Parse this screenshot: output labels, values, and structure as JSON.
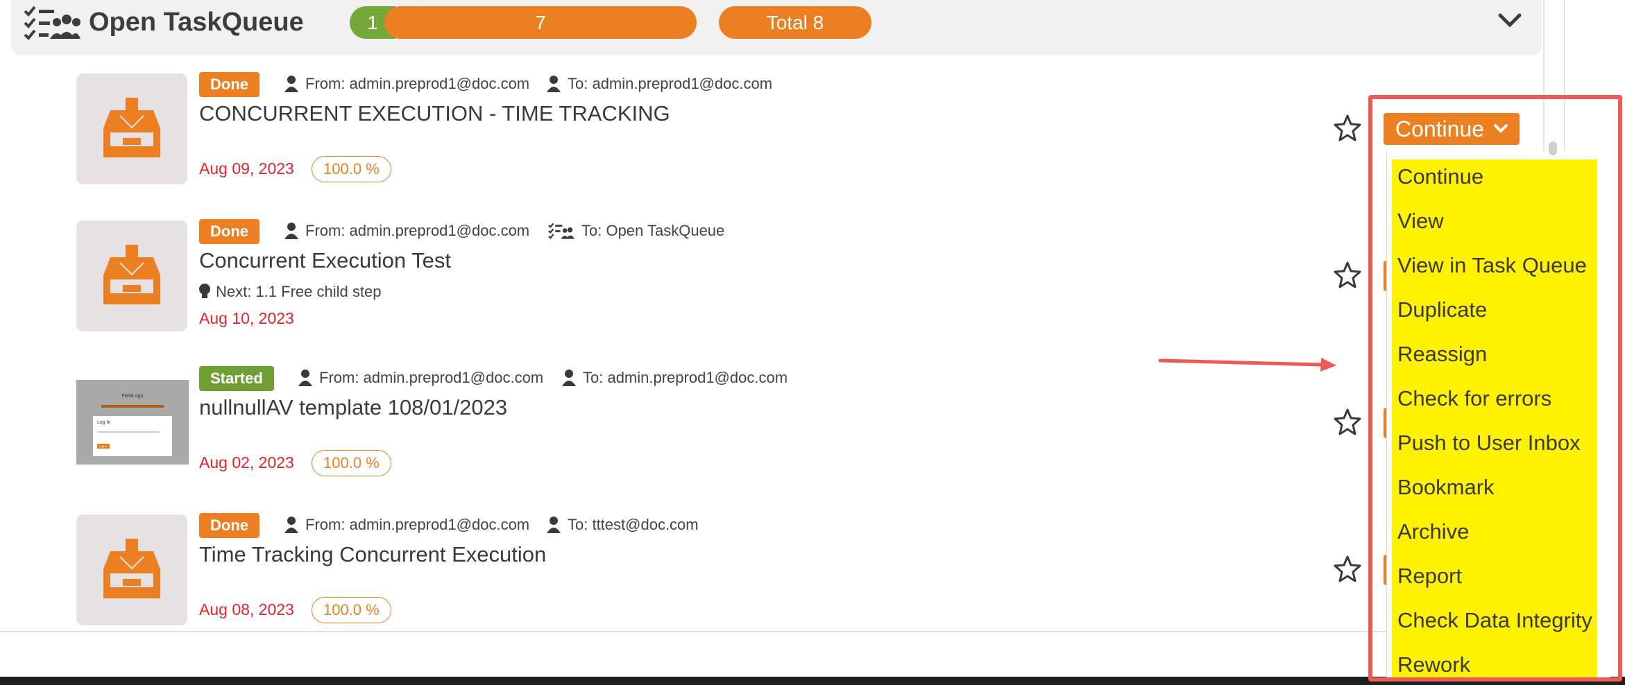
{
  "header": {
    "title": "Open TaskQueue",
    "count_green": "1",
    "count_orange": "7",
    "total": "Total 8"
  },
  "tasks": [
    {
      "status": "Done",
      "from": "From: admin.preprod1@doc.com",
      "to": "To: admin.preprod1@doc.com",
      "title": "CONCURRENT EXECUTION - TIME TRACKING",
      "date": "Aug 09, 2023",
      "progress": "100.0 %"
    },
    {
      "status": "Done",
      "from": "From: admin.preprod1@doc.com",
      "to": "To: Open TaskQueue",
      "title": "Concurrent Execution Test",
      "next": "Next: 1.1 Free child step",
      "date": "Aug 10, 2023"
    },
    {
      "status": "Started",
      "from": "From: admin.preprod1@doc.com",
      "to": "To: admin.preprod1@doc.com",
      "title": "nullnullAV template 108/01/2023",
      "date": "Aug 02, 2023",
      "progress": "100.0 %",
      "thumbnail": {
        "logo": "FieldLogo",
        "heading": "Log In",
        "button": "Log In"
      }
    },
    {
      "status": "Done",
      "from": "From: admin.preprod1@doc.com",
      "to": "To: tttest@doc.com",
      "title": "Time Tracking Concurrent Execution",
      "date": "Aug 08, 2023",
      "progress": "100.0 %"
    }
  ],
  "dropdown": {
    "button_label": "Continue",
    "items": [
      "Continue",
      "View",
      "View in Task Queue",
      "Duplicate",
      "Reassign",
      "Check for errors",
      "Push to User Inbox",
      "Bookmark",
      "Archive",
      "Report",
      "Check Data Integrity",
      "Rework"
    ]
  },
  "colors": {
    "accent": "#ec7f22",
    "started": "#6f9f35",
    "date": "#e5222a",
    "highlight": "#fff200",
    "annotation": "#ee5a55"
  },
  "icons": {
    "header": "task-queue-icon",
    "thumb": "inbox-download-icon",
    "person": "user-icon",
    "next": "lightbulb-icon",
    "favorite": "star-icon",
    "collapse": "chevron-down-icon"
  }
}
